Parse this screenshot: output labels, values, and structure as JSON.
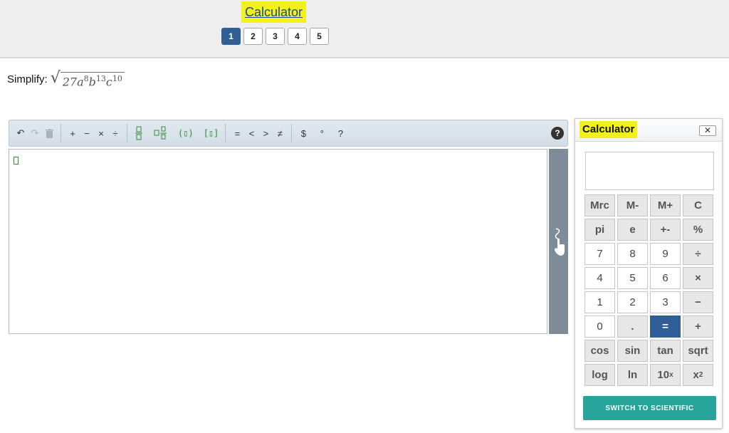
{
  "header": {
    "calculator_link": "Calculator",
    "pages": [
      "1",
      "2",
      "3",
      "4",
      "5"
    ],
    "active_page": "1"
  },
  "question": {
    "prompt": "Simplify:",
    "coef": "27",
    "v1": "a",
    "e1": "8",
    "v2": "b",
    "e2": "13",
    "v3": "c",
    "e3": "10"
  },
  "toolbar": {
    "undo": "↶",
    "redo": "↷",
    "delete": "🗑",
    "plus": "+",
    "minus": "−",
    "times": "×",
    "divide": "÷",
    "fraction": "▯/▯",
    "mixed_fraction": "▯▯/▯",
    "parentheses": "(▯)",
    "brackets": "[▯]",
    "equals": "=",
    "less_than": "<",
    "greater_than": ">",
    "not_equal": "≠",
    "dollar": "$",
    "degree": "°",
    "question": "?",
    "help": "?"
  },
  "calculator": {
    "title": "Calculator",
    "close": "✕",
    "display": "",
    "keys": [
      "Mrc",
      "M-",
      "M+",
      "C",
      "pi",
      "e",
      "+-",
      "%",
      "7",
      "8",
      "9",
      "÷",
      "4",
      "5",
      "6",
      "×",
      "1",
      "2",
      "3",
      "−",
      "0",
      ".",
      "=",
      "+",
      "cos",
      "sin",
      "tan",
      "sqrt",
      "log",
      "ln",
      "10",
      "x"
    ],
    "key_superscripts": {
      "30": "x",
      "31": "2"
    },
    "switch_label": "SWITCH TO SCIENTIFIC"
  },
  "colors": {
    "highlight": "#f2f21a",
    "primary": "#2f5f96",
    "teal": "#27a59a"
  }
}
